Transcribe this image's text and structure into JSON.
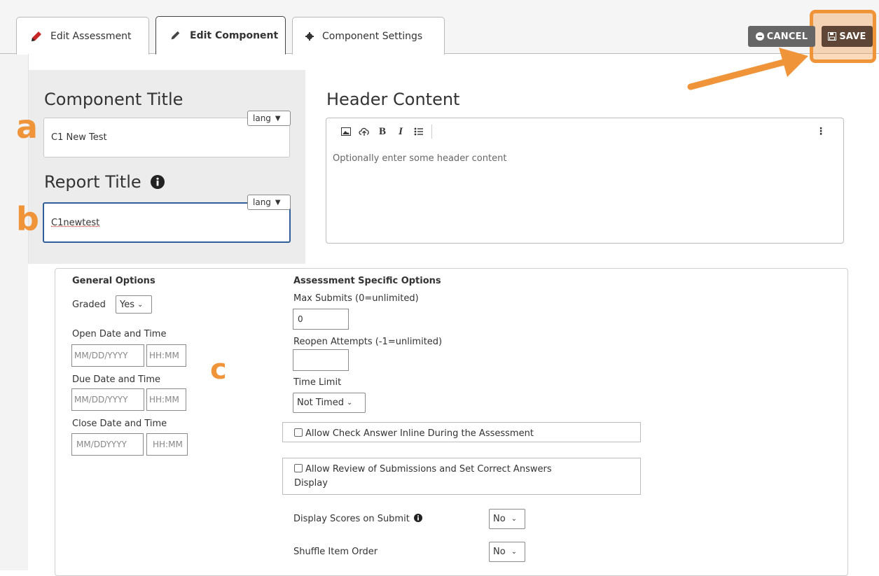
{
  "tabs": [
    {
      "label": "Edit Assessment",
      "icon": "pencil-icon"
    },
    {
      "label": "Edit Component",
      "icon": "pencil-icon"
    },
    {
      "label": "Component Settings",
      "icon": "gear-icon"
    }
  ],
  "actions": {
    "cancel_label": "CANCEL",
    "save_label": "SAVE"
  },
  "component_title": {
    "label": "Component Title",
    "value": "C1 New Test",
    "lang": "lang"
  },
  "report_title": {
    "label": "Report Title",
    "value": "C1newtest",
    "lang": "lang"
  },
  "header_content": {
    "label": "Header Content",
    "placeholder": "Optionally enter some header content"
  },
  "annotations": {
    "a": "a",
    "b": "b",
    "c": "c"
  },
  "general_options": {
    "heading": "General Options",
    "graded_label": "Graded",
    "graded_value": "Yes",
    "open_label": "Open Date and Time",
    "open_date_placeholder": "MM/DD/YYYY",
    "open_time_placeholder": "HH:MM",
    "due_label": "Due Date and Time",
    "due_date_placeholder": "MM/DD/YYYY",
    "due_time_placeholder": "HH:MM",
    "close_label": "Close Date and Time",
    "close_date_placeholder": "MM/DDYYYY",
    "close_time_placeholder": "HH:MM"
  },
  "assessment_options": {
    "heading": "Assessment Specific Options",
    "max_submits_label": "Max Submits (0=unlimited)",
    "max_submits_value": "0",
    "reopen_label": "Reopen Attempts (-1=unlimited)",
    "reopen_value": "",
    "time_limit_label": "Time Limit",
    "time_limit_value": "Not Timed",
    "check_inline_label": "Allow Check Answer Inline During the Assessment",
    "review_label_line1": "Allow Review of Submissions and Set Correct Answers",
    "review_label_line2": "Display",
    "display_scores_label": "Display Scores on Submit",
    "display_scores_value": "No",
    "shuffle_label": "Shuffle Item Order",
    "shuffle_value": "No"
  },
  "colors": {
    "accent_orange": "#f0943a",
    "save_brown": "#5e4535",
    "cancel_gray": "#666666",
    "focus_blue": "#2f5f98"
  }
}
